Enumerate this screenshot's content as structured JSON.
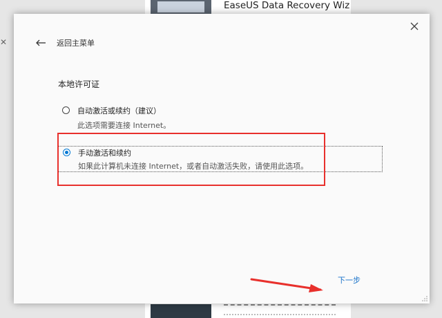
{
  "background_app": {
    "product_title": "EaseUS Data Recovery Wiz"
  },
  "dialog": {
    "back_label": "返回主菜单",
    "section_title": "本地许可证",
    "options": [
      {
        "label": "自动激活或续约（建议）",
        "description": "此选项需要连接 Internet。",
        "selected": false
      },
      {
        "label": "手动激活和续约",
        "description": "如果此计算机未连接 Internet，或者自动激活失败，请使用此选项。",
        "selected": true
      }
    ],
    "next_label": "下一步"
  },
  "colors": {
    "accent": "#0078d4",
    "link": "#1a73c9",
    "annotation_red": "#e8302c"
  },
  "icons": {
    "back": "arrow-left-icon",
    "close": "close-icon"
  }
}
